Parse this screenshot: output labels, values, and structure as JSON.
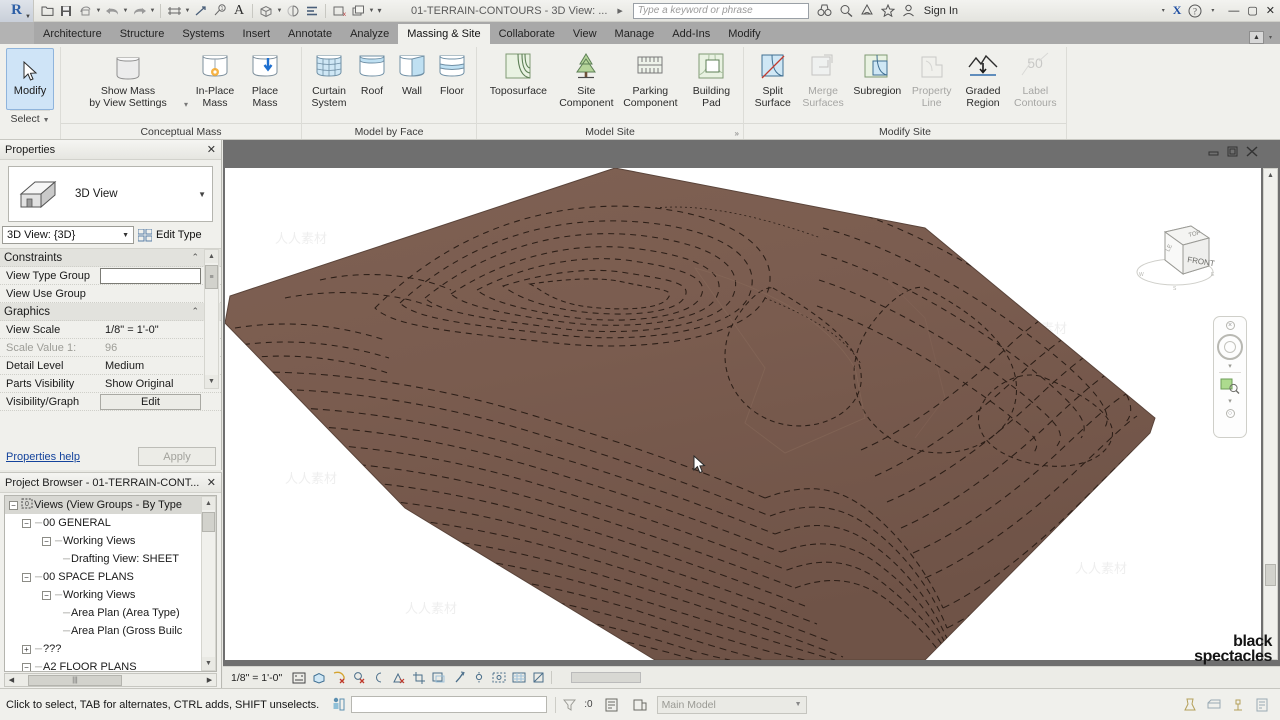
{
  "titlebar": {
    "app_icon": "revit-logo",
    "document_title": "01-TERRAIN-CONTOURS - 3D View: ...",
    "search_placeholder": "Type a keyword or phrase",
    "sign_in_label": "Sign In",
    "quick_access": [
      {
        "name": "open-icon",
        "glyph": "⮏"
      },
      {
        "name": "save-icon",
        "glyph": "Ὃe"
      },
      {
        "name": "save-as-icon",
        "glyph": "⬡"
      },
      {
        "name": "undo-icon",
        "glyph": "↶"
      },
      {
        "name": "redo-icon",
        "glyph": "↷"
      },
      {
        "name": "align-dimension-icon",
        "glyph": "≡"
      },
      {
        "name": "measure-icon",
        "glyph": "↗"
      },
      {
        "name": "tag-icon",
        "glyph": "ⓘ"
      },
      {
        "name": "text-icon",
        "glyph": "A"
      },
      {
        "name": "default-3d-view-icon",
        "glyph": "⬡"
      },
      {
        "name": "section-icon",
        "glyph": "◔"
      },
      {
        "name": "thin-lines-icon",
        "glyph": "☰"
      },
      {
        "name": "close-hidden-windows-icon",
        "glyph": "⧉"
      },
      {
        "name": "switch-windows-icon",
        "glyph": "⧉"
      }
    ],
    "right_icons": [
      {
        "name": "autodesk-a360-icon",
        "glyph": "⚖"
      },
      {
        "name": "help-search-icon",
        "glyph": "⌕"
      },
      {
        "name": "communication-center-icon",
        "glyph": "⍒"
      },
      {
        "name": "favorites-star-icon",
        "glyph": "☆"
      },
      {
        "name": "user-account-icon",
        "glyph": "⚹"
      }
    ],
    "exchange_label": "X",
    "help_label": "?",
    "window_buttons": [
      "—",
      "☐",
      "✕"
    ]
  },
  "tabs": [
    {
      "label": "Architecture",
      "active": false
    },
    {
      "label": "Structure",
      "active": false
    },
    {
      "label": "Systems",
      "active": false
    },
    {
      "label": "Insert",
      "active": false
    },
    {
      "label": "Annotate",
      "active": false
    },
    {
      "label": "Analyze",
      "active": false
    },
    {
      "label": "Massing & Site",
      "active": true
    },
    {
      "label": "Collaborate",
      "active": false
    },
    {
      "label": "View",
      "active": false
    },
    {
      "label": "Manage",
      "active": false
    },
    {
      "label": "Add-Ins",
      "active": false
    },
    {
      "label": "Modify",
      "active": false
    }
  ],
  "ribbon": {
    "select_panel": {
      "modify_label": "Modify",
      "panel_title": "Select",
      "icon": "arrow-cursor-icon"
    },
    "panels": [
      {
        "title": "Conceptual Mass",
        "expand": false,
        "buttons": [
          {
            "label": "Show Mass\nby View Settings",
            "icon": "mass-solid-icon",
            "disabled": false,
            "wide": true
          },
          {
            "label": "In-Place\nMass",
            "icon": "in-place-mass-icon",
            "disabled": false
          },
          {
            "label": "Place\nMass",
            "icon": "place-mass-icon",
            "disabled": false
          }
        ]
      },
      {
        "title": "Model by Face",
        "expand": false,
        "buttons": [
          {
            "label": "Curtain\nSystem",
            "icon": "curtain-system-icon",
            "disabled": false
          },
          {
            "label": "Roof",
            "icon": "roof-by-face-icon",
            "disabled": false
          },
          {
            "label": "Wall",
            "icon": "wall-by-face-icon",
            "disabled": false
          },
          {
            "label": "Floor",
            "icon": "floor-by-face-icon",
            "disabled": false
          }
        ]
      },
      {
        "title": "Model Site",
        "expand": true,
        "buttons": [
          {
            "label": "Toposurface",
            "icon": "toposurface-icon",
            "disabled": false
          },
          {
            "label": "Site\nComponent",
            "icon": "site-component-tree-icon",
            "disabled": false
          },
          {
            "label": "Parking\nComponent",
            "icon": "parking-component-icon",
            "disabled": false
          },
          {
            "label": "Building\nPad",
            "icon": "building-pad-icon",
            "disabled": false
          }
        ]
      },
      {
        "title": "Modify Site",
        "expand": false,
        "buttons": [
          {
            "label": "Split\nSurface",
            "icon": "split-surface-icon",
            "disabled": false
          },
          {
            "label": "Merge\nSurfaces",
            "icon": "merge-surfaces-icon",
            "disabled": true
          },
          {
            "label": "Subregion",
            "icon": "subregion-icon",
            "disabled": false
          },
          {
            "label": "Property\nLine",
            "icon": "property-line-icon",
            "disabled": true
          },
          {
            "label": "Graded\nRegion",
            "icon": "graded-region-icon",
            "disabled": false
          },
          {
            "label": "Label\nContours",
            "icon": "label-contours-icon",
            "disabled": true
          }
        ]
      }
    ]
  },
  "properties": {
    "title": "Properties",
    "close_label": "✕",
    "type_name": "3D View",
    "type_icon": "house-3d-icon",
    "instance_selector": "3D View: {3D}",
    "edit_type_label": "Edit Type",
    "help_link": "Properties help",
    "apply_label": "Apply",
    "groups": [
      {
        "name": "Constraints",
        "rows": [
          {
            "name": "View Type Group",
            "value": "",
            "style": "focus"
          },
          {
            "name": "View Use Group",
            "value": "",
            "style": "plain"
          }
        ]
      },
      {
        "name": "Graphics",
        "rows": [
          {
            "name": "View Scale",
            "value": "1/8\" = 1'-0\"",
            "style": "plain"
          },
          {
            "name": "Scale Value    1:",
            "value": "96",
            "style": "dim"
          },
          {
            "name": "Detail Level",
            "value": "Medium",
            "style": "plain"
          },
          {
            "name": "Parts Visibility",
            "value": "Show Original",
            "style": "plain"
          },
          {
            "name": "Visibility/Graph",
            "value": "Edit",
            "style": "button"
          }
        ]
      }
    ]
  },
  "project_browser": {
    "title": "Project Browser - 01-TERRAIN-CONT...",
    "close_label": "✕",
    "nodes": [
      {
        "label": "Views (View Groups - By Type",
        "depth": 0,
        "expander": "-",
        "selected": true,
        "icon": "views-icon"
      },
      {
        "label": "00 GENERAL",
        "depth": 1,
        "expander": "-",
        "selected": false,
        "icon": ""
      },
      {
        "label": "Working Views",
        "depth": 2,
        "expander": "-",
        "selected": false,
        "icon": ""
      },
      {
        "label": "Drafting View: SHEET",
        "depth": 3,
        "expander": "",
        "selected": false,
        "icon": ""
      },
      {
        "label": "00 SPACE PLANS",
        "depth": 1,
        "expander": "-",
        "selected": false,
        "icon": ""
      },
      {
        "label": "Working Views",
        "depth": 2,
        "expander": "-",
        "selected": false,
        "icon": ""
      },
      {
        "label": "Area Plan (Area Type)",
        "depth": 3,
        "expander": "",
        "selected": false,
        "icon": ""
      },
      {
        "label": "Area Plan (Gross Builc",
        "depth": 3,
        "expander": "",
        "selected": false,
        "icon": ""
      },
      {
        "label": "???",
        "depth": 1,
        "expander": "+",
        "selected": false,
        "icon": ""
      },
      {
        "label": "A2 FLOOR PLANS",
        "depth": 1,
        "expander": "-",
        "selected": false,
        "icon": ""
      }
    ]
  },
  "view": {
    "window_controls": [
      "minimize",
      "restore",
      "close"
    ],
    "scale_label": "1/8\" = 1'-0\"",
    "viewcube_faces": {
      "top": "TOP",
      "front": "FRONT",
      "left": "LEFT"
    },
    "viewcube_compass": [
      "N",
      "E",
      "S",
      "W"
    ],
    "control_bar_icons": [
      {
        "name": "scale-icon",
        "glyph": "⬚"
      },
      {
        "name": "detail-level-icon",
        "glyph": "⬡"
      },
      {
        "name": "visual-style-icon",
        "glyph": "◑"
      },
      {
        "name": "sun-path-icon",
        "glyph": "☼"
      },
      {
        "name": "shadows-icon",
        "glyph": "◕"
      },
      {
        "name": "rendering-dialog-icon",
        "glyph": "✸"
      },
      {
        "name": "crop-view-icon",
        "glyph": "⌗"
      },
      {
        "name": "show-crop-region-icon",
        "glyph": "⬜"
      },
      {
        "name": "lock-3d-view-icon",
        "glyph": "⚿"
      },
      {
        "name": "temporary-hide-isolate-icon",
        "glyph": "⌽"
      },
      {
        "name": "reveal-hidden-elements-icon",
        "glyph": "⌗"
      },
      {
        "name": "analytical-model-icon",
        "glyph": "▧"
      },
      {
        "name": "constraints-icon",
        "glyph": "◩"
      }
    ],
    "terrain_color": "#7b5d50",
    "terrain_contour_color": "#2b1d16",
    "background_color": "#ffffff",
    "watermark_text": "人人素材"
  },
  "branding": {
    "line1": "black",
    "line2": "spectacles"
  },
  "status_bar": {
    "message": "Click to select, TAB for alternates, CTRL adds, SHIFT unselects.",
    "filter_count": ":0",
    "worksets_label": "Main Model",
    "left_icons": [
      {
        "name": "model-interaction-icon",
        "glyph": "⚲"
      }
    ],
    "right_icons": [
      {
        "name": "design-options-icon",
        "glyph": "⚗"
      },
      {
        "name": "exclude-options-icon",
        "glyph": "▤"
      },
      {
        "name": "active-design-option-icon",
        "glyph": "⛩"
      },
      {
        "name": "editable-only-icon",
        "glyph": "⌸"
      }
    ]
  }
}
